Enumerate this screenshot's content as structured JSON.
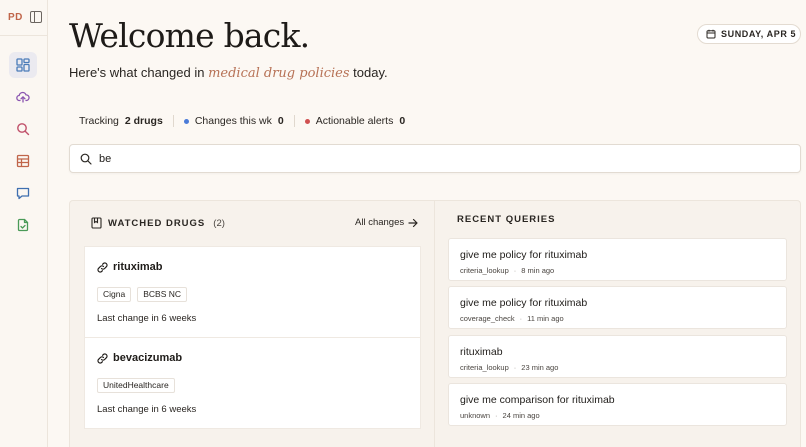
{
  "brand": {
    "initials": "PD"
  },
  "nav": [
    {
      "name": "dashboard",
      "icon": "dashboard-icon",
      "color": "#4a7bb8",
      "active": true
    },
    {
      "name": "upload",
      "icon": "cloud-upload-icon",
      "color": "#8a55b0"
    },
    {
      "name": "search",
      "icon": "search-icon",
      "color": "#c0506a"
    },
    {
      "name": "table",
      "icon": "table-icon",
      "color": "#c0654a"
    },
    {
      "name": "chat",
      "icon": "chat-icon",
      "color": "#3f6fb0"
    },
    {
      "name": "file-check",
      "icon": "file-check-icon",
      "color": "#4a9a58"
    }
  ],
  "header": {
    "title": "Welcome back.",
    "subtitle_before": "Here's what changed in ",
    "subtitle_accent": "medical drug policies",
    "subtitle_after": " today.",
    "date": "SUNDAY, APR 5"
  },
  "stats": {
    "tracking_label": "Tracking",
    "tracking_value": "2 drugs",
    "changes_label": "Changes this wk",
    "changes_value": "0",
    "alerts_label": "Actionable alerts",
    "alerts_value": "0",
    "changes_dot_color": "#4a7bd8",
    "alerts_dot_color": "#d05050"
  },
  "search": {
    "value": "be"
  },
  "watched": {
    "title": "WATCHED DRUGS",
    "count": "(2)",
    "all_changes": "All changes",
    "drugs": [
      {
        "name": "rituximab",
        "tags": [
          "Cigna",
          "BCBS NC"
        ],
        "last_change": "Last change in 6 weeks"
      },
      {
        "name": "bevacizumab",
        "tags": [
          "UnitedHealthcare"
        ],
        "last_change": "Last change in 6 weeks"
      }
    ]
  },
  "recent": {
    "title": "RECENT QUERIES",
    "queries": [
      {
        "text": "give me policy for rituximab",
        "type": "criteria_lookup",
        "time": "8 min ago"
      },
      {
        "text": "give me policy for rituximab",
        "type": "coverage_check",
        "time": "11 min ago"
      },
      {
        "text": "rituximab",
        "type": "criteria_lookup",
        "time": "23 min ago"
      },
      {
        "text": "give me comparison for rituximab",
        "type": "unknown",
        "time": "24 min ago"
      }
    ]
  }
}
